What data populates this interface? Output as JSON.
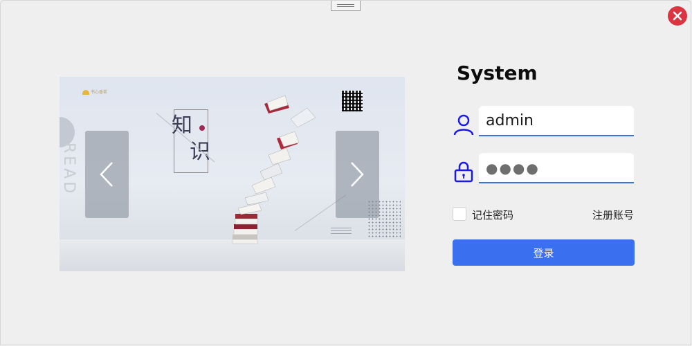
{
  "window": {
    "close_icon": "close-icon",
    "drag_icon": "drag-handle-icon"
  },
  "carousel": {
    "brand_text": "书心香茗",
    "title_line1": "知",
    "title_line2": "识",
    "side_text": "READ",
    "prev_icon": "chevron-left-icon",
    "next_icon": "chevron-right-icon"
  },
  "login": {
    "title": "System",
    "username_value": "admin",
    "password_mask": "●●●●",
    "remember_label": "记住密码",
    "register_label": "注册账号",
    "login_label": "登录",
    "user_icon": "user-icon",
    "lock_icon": "lock-icon",
    "accent_color": "#3a6ff0",
    "icon_color": "#1a1ae6"
  }
}
